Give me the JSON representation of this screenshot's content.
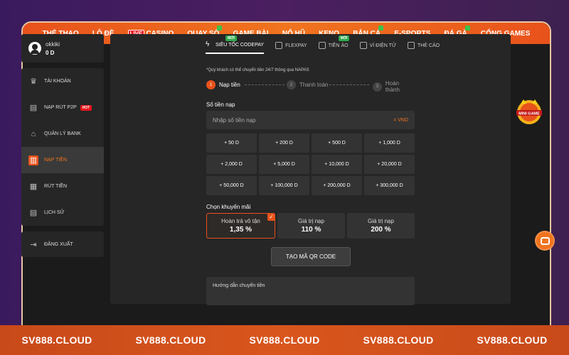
{
  "topnav": [
    {
      "label": "THỂ THAO",
      "live": false,
      "dot": false
    },
    {
      "label": "LÔ ĐỀ",
      "live": false,
      "dot": false
    },
    {
      "label": "CASINO",
      "live": true,
      "dot": false
    },
    {
      "label": "QUAY SỐ",
      "live": false,
      "dot": true
    },
    {
      "label": "GAME BÀI",
      "live": false,
      "dot": false
    },
    {
      "label": "NỔ HŨ",
      "live": false,
      "dot": false
    },
    {
      "label": "KENO",
      "live": false,
      "dot": false
    },
    {
      "label": "BẮN CÁ",
      "live": false,
      "dot": true
    },
    {
      "label": "E-SPORTS",
      "live": false,
      "dot": false
    },
    {
      "label": "ĐÁ GÀ",
      "live": false,
      "dot": true
    },
    {
      "label": "CỔNG GAMES",
      "live": false,
      "dot": false
    }
  ],
  "live_badge": "LIVE",
  "user": {
    "name": "okkiki",
    "balance": "0 D"
  },
  "menu": [
    {
      "label": "TÀI KHOẢN",
      "icon": "crown-icon",
      "glyph": "♛",
      "active": false
    },
    {
      "label": "NẠP RÚT P2P",
      "icon": "transfer-icon",
      "glyph": "▤",
      "active": false,
      "hot": "HOT"
    },
    {
      "label": "QUẢN LÝ BANK",
      "icon": "bank-icon",
      "glyph": "⌂",
      "active": false
    },
    {
      "label": "NẠP TIỀN",
      "icon": "deposit-icon",
      "glyph": "▥",
      "active": true
    },
    {
      "label": "RÚT TIỀN",
      "icon": "withdraw-icon",
      "glyph": "▦",
      "active": false
    },
    {
      "label": "LỊCH SỬ",
      "icon": "history-icon",
      "glyph": "▤",
      "active": false
    }
  ],
  "logout": {
    "label": "ĐĂNG XUẤT",
    "icon": "logout-icon",
    "glyph": "⇥"
  },
  "pay_tabs": [
    {
      "label": "SIÊU TỐC CODEPAY",
      "active": true,
      "badge": "MỚI"
    },
    {
      "label": "FLEXPAY",
      "active": false,
      "badge": ""
    },
    {
      "label": "TIỀN ẢO",
      "active": false,
      "badge": "MỚI"
    },
    {
      "label": "VÍ ĐIỆN TỬ",
      "active": false,
      "badge": ""
    },
    {
      "label": "THẺ CÀO",
      "active": false,
      "badge": ""
    }
  ],
  "note": "*Quý khách có thể chuyển tiền 24/7 thông qua NAPAS",
  "steps": [
    {
      "num": "1",
      "label": "Nạp tiền",
      "active": true
    },
    {
      "num": "2",
      "label": "Thanh toán",
      "active": false
    },
    {
      "num": "3",
      "label": "Hoàn thành",
      "active": false
    }
  ],
  "amount_label": "Số tiền nạp",
  "amount_placeholder": "Nhập số tiền nạp",
  "currency": "= VND",
  "amounts": [
    "+ 50 D",
    "+ 200 D",
    "+ 500 D",
    "+ 1,000 D",
    "+ 2,000 D",
    "+ 5,000 D",
    "+ 10,000 D",
    "+ 20,000 D",
    "+ 50,000 D",
    "+ 100,000 D",
    "+ 200,000 D",
    "+ 300,000 D"
  ],
  "promo_label": "Chọn khuyến mãi",
  "promos": [
    {
      "title": "Hoàn trả vô tận",
      "value": "1,35 %",
      "selected": true
    },
    {
      "title": "Giá trị nạp",
      "value": "110 %",
      "selected": false
    },
    {
      "title": "Giá trị nạp",
      "value": "200 %",
      "selected": false
    }
  ],
  "check_glyph": "✓",
  "qr_button": "TẠO MÃ QR CODE",
  "guide_title": "Hướng dẫn chuyển tiền",
  "jackpot_text": "MINI GAME",
  "brand": [
    "SV888.CLOUD",
    "SV888.CLOUD",
    "SV888.CLOUD",
    "SV888.CLOUD",
    "SV888.CLOUD"
  ],
  "colors": {
    "accent": "#e8521b",
    "nav": "#f0741f",
    "panel": "#262626"
  }
}
